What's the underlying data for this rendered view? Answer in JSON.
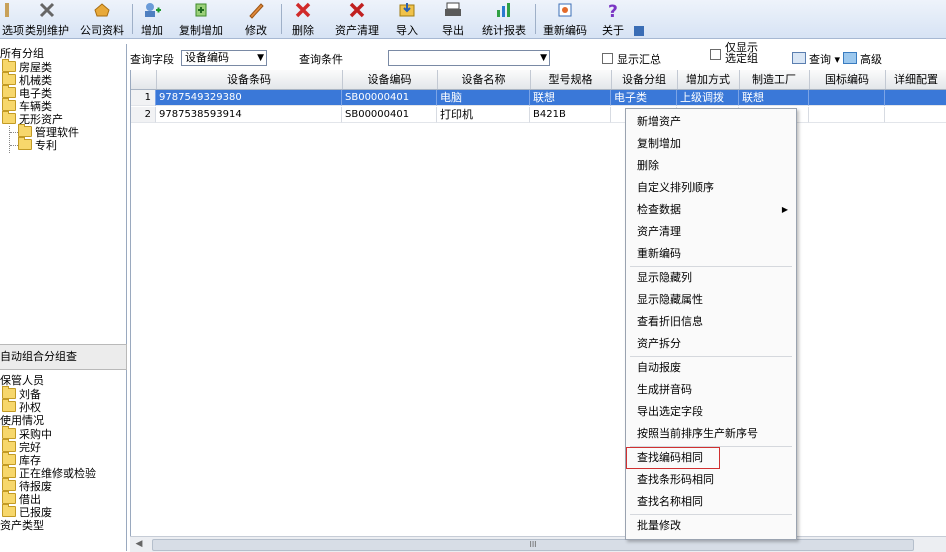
{
  "toolbar": {
    "items": [
      {
        "label": "选项"
      },
      {
        "label": "类别维护"
      },
      {
        "label": "公司资料"
      },
      {
        "label": "增加"
      },
      {
        "label": "复制增加"
      },
      {
        "label": "修改"
      },
      {
        "label": "删除"
      },
      {
        "label": "资产清理"
      },
      {
        "label": "导入"
      },
      {
        "label": "导出"
      },
      {
        "label": "统计报表"
      },
      {
        "label": "重新编码"
      },
      {
        "label": "关于"
      }
    ]
  },
  "left_tree": {
    "root": "所有分组",
    "items": [
      "房屋类",
      "机械类",
      "电子类",
      "车辆类",
      "无形资产",
      "管理软件",
      "专利"
    ]
  },
  "left_mid": {
    "title": "自动组合分组查"
  },
  "left_bottom": {
    "items": [
      "保管人员",
      "刘备",
      "孙权",
      "使用情况",
      "采购中",
      "完好",
      "库存",
      "正在维修或检验",
      "待报废",
      "借出",
      "已报废",
      "资产类型"
    ]
  },
  "query": {
    "field_label": "查询字段",
    "field_value": "设备编码",
    "cond_label": "查询条件",
    "cond_value": "",
    "show_summary": "显示汇总",
    "only_selected": "仅显示选定组",
    "query_btn": "查询",
    "advanced_btn": "高级"
  },
  "grid": {
    "columns": [
      "",
      "设备条码",
      "设备编码",
      "设备名称",
      "型号规格",
      "设备分组",
      "增加方式",
      "制造工厂",
      "国标编码",
      "详细配置"
    ],
    "rows": [
      [
        "1",
        "9787549329380",
        "SB00000401",
        "电脑",
        "联想",
        "电子类",
        "上级调拨",
        "联想",
        "",
        ""
      ],
      [
        "2",
        "9787538593914",
        "SB00000401",
        "打印机",
        "B421B",
        "",
        "",
        "",
        "",
        ""
      ]
    ]
  },
  "context_menu": {
    "items": [
      "新增资产",
      "复制增加",
      "删除",
      "自定义排列顺序",
      "检查数据",
      "资产清理",
      "重新编码",
      "显示隐藏列",
      "显示隐藏属性",
      "查看折旧信息",
      "资产拆分",
      "自动报废",
      "生成拼音码",
      "导出选定字段",
      "按照当前排序生产新序号",
      "查找编码相同",
      "查找条形码相同",
      "查找名称相同",
      "批量修改"
    ],
    "highlighted": "查找编码相同"
  },
  "scrollbar": {
    "thumb_label": "III"
  }
}
